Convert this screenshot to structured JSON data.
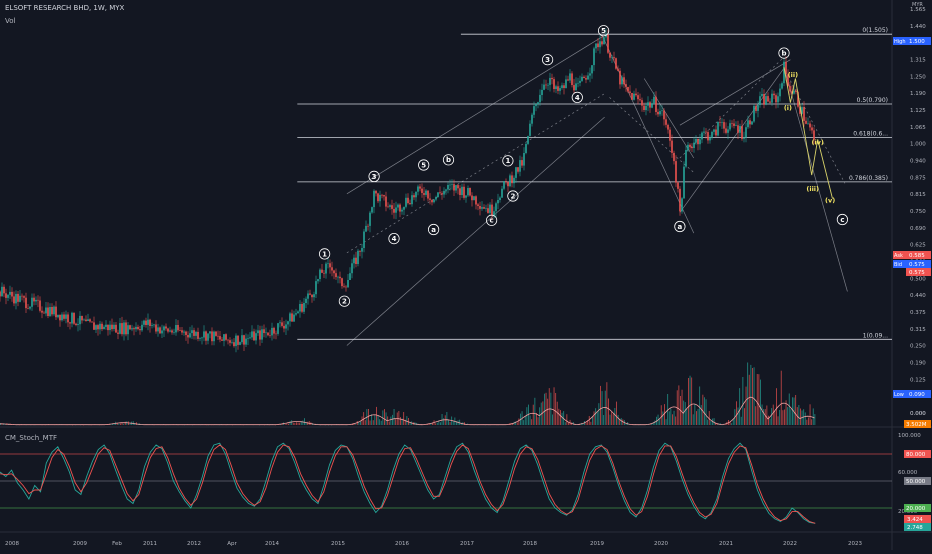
{
  "header": {
    "symbol": "ELSOFT RESEARCH BHD, 1W, MYX",
    "volume_label": "Vol",
    "oscillator_label": "CM_Stoch_MTF",
    "currency": "MYR"
  },
  "colors": {
    "background": "#131722",
    "up": "#26a69a",
    "down": "#ef5350",
    "line": "#d1d4dc",
    "wave_label": "#ffffff",
    "wave_label_yellow": "#f5e663",
    "yellow_line": "#d9d36a",
    "vol_ma": "#f2a0a0",
    "stoch_k": "#26a69a",
    "stoch_d": "#ef5350",
    "level_red": "#ef5350",
    "level_green": "#4caf50"
  },
  "chart_data": [
    {
      "type": "candlestick",
      "pane": "price",
      "title": "ELSOFT RESEARCH BHD, 1W, MYX",
      "y_scale": "log",
      "ylim": [
        0.015,
        1.565
      ],
      "x_axis_labels": [
        "2008",
        "2009",
        "Feb",
        "2011",
        "2012",
        "Apr",
        "2014",
        "2015",
        "2016",
        "2017",
        "2018",
        "2019",
        "2020",
        "2021",
        "2022",
        "2023"
      ],
      "y_axis_ticks": [
        "1.565",
        "1.440",
        "1.375",
        "1.315",
        "1.250",
        "1.190",
        "1.125",
        "1.065",
        "1.000",
        "0.940",
        "0.875",
        "0.815",
        "0.750",
        "0.690",
        "0.625",
        "0.560",
        "0.500",
        "0.440",
        "0.375",
        "0.315",
        "0.250",
        "0.190",
        "0.125",
        "0.065",
        "0.000"
      ],
      "price_path": [
        [
          2007.0,
          0.14
        ],
        [
          2007.5,
          0.128
        ],
        [
          2008.3,
          0.112
        ],
        [
          2008.8,
          0.102
        ],
        [
          2009.5,
          0.1
        ],
        [
          2010.0,
          0.104
        ],
        [
          2010.3,
          0.098
        ],
        [
          2010.8,
          0.096
        ],
        [
          2011.2,
          0.094
        ],
        [
          2011.5,
          0.089
        ],
        [
          2012.0,
          0.091
        ],
        [
          2012.4,
          0.096
        ],
        [
          2012.8,
          0.106
        ],
        [
          2013.0,
          0.116
        ],
        [
          2013.3,
          0.14
        ],
        [
          2013.5,
          0.168
        ],
        [
          2013.7,
          0.178
        ],
        [
          2013.85,
          0.15
        ],
        [
          2014.0,
          0.154
        ],
        [
          2014.3,
          0.215
        ],
        [
          2014.55,
          0.345
        ],
        [
          2014.75,
          0.32
        ],
        [
          2014.95,
          0.295
        ],
        [
          2015.15,
          0.32
        ],
        [
          2015.4,
          0.345
        ],
        [
          2015.55,
          0.36
        ],
        [
          2015.75,
          0.328
        ],
        [
          2015.9,
          0.35
        ],
        [
          2016.1,
          0.365
        ],
        [
          2016.3,
          0.36
        ],
        [
          2016.5,
          0.34
        ],
        [
          2016.8,
          0.305
        ],
        [
          2016.92,
          0.295
        ],
        [
          2017.05,
          0.34
        ],
        [
          2017.25,
          0.385
        ],
        [
          2017.55,
          0.46
        ],
        [
          2017.75,
          0.72
        ],
        [
          2017.95,
          0.95
        ],
        [
          2018.1,
          1.0
        ],
        [
          2018.2,
          0.88
        ],
        [
          2018.35,
          0.905
        ],
        [
          2018.5,
          1.02
        ],
        [
          2018.65,
          0.9
        ],
        [
          2018.9,
          1.1
        ],
        [
          2019.05,
          1.38
        ],
        [
          2019.2,
          1.49
        ],
        [
          2019.35,
          1.2
        ],
        [
          2019.5,
          1.0
        ],
        [
          2019.65,
          0.88
        ],
        [
          2019.85,
          0.83
        ],
        [
          2020.0,
          0.78
        ],
        [
          2020.2,
          0.8
        ],
        [
          2020.4,
          0.7
        ],
        [
          2020.6,
          0.48
        ],
        [
          2020.72,
          0.29
        ],
        [
          2020.85,
          0.52
        ],
        [
          2021.0,
          0.56
        ],
        [
          2021.2,
          0.6
        ],
        [
          2021.4,
          0.59
        ],
        [
          2021.55,
          0.68
        ],
        [
          2021.7,
          0.62
        ],
        [
          2021.85,
          0.65
        ],
        [
          2022.0,
          0.6
        ],
        [
          2022.15,
          0.7
        ],
        [
          2022.35,
          0.82
        ],
        [
          2022.55,
          0.82
        ],
        [
          2022.7,
          0.84
        ],
        [
          2022.82,
          1.11
        ],
        [
          2022.95,
          0.9
        ],
        [
          2023.05,
          0.86
        ],
        [
          2023.15,
          0.76
        ],
        [
          2023.3,
          0.65
        ],
        [
          2023.45,
          0.56
        ]
      ],
      "horizontal_levels": [
        {
          "label": "0(1.505)",
          "value": 1.505
        },
        {
          "label": "0.5(0.790)",
          "value": 0.79
        },
        {
          "label": "0.618(0.6...",
          "value": 0.58
        },
        {
          "label": "0.786(0.385)",
          "value": 0.385
        },
        {
          "label": "1(0.09...",
          "value": 0.09
        }
      ],
      "price_tags": [
        {
          "label": "High",
          "value": "1.500",
          "color": "#2962ff"
        },
        {
          "label": "Ask",
          "value": "0.585",
          "color": "#ef5350"
        },
        {
          "label": "Bid",
          "value": "0.575",
          "color": "#2962ff"
        },
        {
          "label": "",
          "value": "0.575",
          "color": "#ef5350"
        },
        {
          "label": "Low",
          "value": "0.090",
          "color": "#2962ff"
        }
      ],
      "wave_labels": [
        {
          "text": "1",
          "x": 2013.55,
          "y": 0.198,
          "color": "white"
        },
        {
          "text": "2",
          "x": 2013.95,
          "y": 0.128,
          "color": "white"
        },
        {
          "text": "3",
          "x": 2014.55,
          "y": 0.405,
          "color": "white"
        },
        {
          "text": "4",
          "x": 2014.95,
          "y": 0.228,
          "color": "white"
        },
        {
          "text": "5",
          "x": 2015.55,
          "y": 0.45,
          "color": "white"
        },
        {
          "text": "a",
          "x": 2015.75,
          "y": 0.248,
          "color": "white"
        },
        {
          "text": "b",
          "x": 2016.05,
          "y": 0.472,
          "color": "white"
        },
        {
          "text": "c",
          "x": 2016.92,
          "y": 0.27,
          "color": "white"
        },
        {
          "text": "1",
          "x": 2017.25,
          "y": 0.468,
          "color": "white"
        },
        {
          "text": "2",
          "x": 2017.35,
          "y": 0.338,
          "color": "white"
        },
        {
          "text": "3",
          "x": 2018.05,
          "y": 1.19,
          "color": "white"
        },
        {
          "text": "4",
          "x": 2018.65,
          "y": 0.84,
          "color": "white"
        },
        {
          "text": "5",
          "x": 2019.18,
          "y": 1.555,
          "color": "white"
        },
        {
          "text": "a",
          "x": 2020.72,
          "y": 0.255,
          "color": "white"
        },
        {
          "text": "b",
          "x": 2022.82,
          "y": 1.265,
          "color": "white"
        },
        {
          "text": "(ii)",
          "x": 2023.0,
          "y": 1.035,
          "color": "yellow"
        },
        {
          "text": "(i)",
          "x": 2022.9,
          "y": 0.765,
          "color": "yellow"
        },
        {
          "text": "(iv)",
          "x": 2023.5,
          "y": 0.555,
          "color": "yellow"
        },
        {
          "text": "(iii)",
          "x": 2023.4,
          "y": 0.362,
          "color": "yellow"
        },
        {
          "text": "(v)",
          "x": 2023.75,
          "y": 0.325,
          "color": "yellow"
        },
        {
          "text": "c",
          "x": 2024.0,
          "y": 0.272,
          "color": "white"
        }
      ],
      "channels": [
        {
          "from": [
            2014.0,
            0.345
          ],
          "to": [
            2019.2,
            1.49
          ],
          "style": "solid"
        },
        {
          "from": [
            2014.0,
            0.2
          ],
          "to": [
            2019.2,
            0.87
          ],
          "style": "dashed"
        },
        {
          "from": [
            2014.0,
            0.085
          ],
          "to": [
            2019.2,
            0.7
          ],
          "style": "solid"
        },
        {
          "from": [
            2019.15,
            1.49
          ],
          "to": [
            2021.0,
            0.24
          ],
          "style": "solid"
        },
        {
          "from": [
            2019.3,
            0.84
          ],
          "to": [
            2021.0,
            0.42
          ],
          "style": "dashed"
        },
        {
          "from": [
            2020.0,
            1.0
          ],
          "to": [
            2021.0,
            0.48
          ],
          "style": "solid"
        },
        {
          "from": [
            2020.72,
            0.29
          ],
          "to": [
            2022.82,
            1.1
          ],
          "style": "solid"
        },
        {
          "from": [
            2020.72,
            0.48
          ],
          "to": [
            2022.82,
            1.22
          ],
          "style": "dashed"
        },
        {
          "from": [
            2020.72,
            0.65
          ],
          "to": [
            2022.95,
            1.19
          ],
          "style": "solid"
        },
        {
          "from": [
            2022.82,
            1.11
          ],
          "to": [
            2024.1,
            0.14
          ],
          "style": "solid"
        },
        {
          "from": [
            2022.95,
            0.98
          ],
          "to": [
            2024.05,
            0.38
          ],
          "style": "dashed"
        }
      ],
      "projection": [
        [
          2022.82,
          1.11
        ],
        [
          2022.95,
          0.8
        ],
        [
          2023.05,
          1.0
        ],
        [
          2023.38,
          0.41
        ],
        [
          2023.5,
          0.57
        ],
        [
          2023.8,
          0.33
        ]
      ]
    },
    {
      "type": "bar",
      "pane": "volume",
      "ylabel": "Vol",
      "y_axis_ticks": [
        "0.000"
      ],
      "volume_tag": "3.502M",
      "peaks": [
        [
          2007.0,
          0.04
        ],
        [
          2009.5,
          0.08
        ],
        [
          2013.0,
          0.12
        ],
        [
          2014.55,
          0.35
        ],
        [
          2015.0,
          0.22
        ],
        [
          2016.0,
          0.18
        ],
        [
          2017.75,
          0.4
        ],
        [
          2018.1,
          0.55
        ],
        [
          2019.2,
          0.6
        ],
        [
          2020.6,
          0.62
        ],
        [
          2021.0,
          0.72
        ],
        [
          2022.15,
          0.95
        ],
        [
          2022.82,
          0.75
        ],
        [
          2023.3,
          0.3
        ]
      ]
    },
    {
      "type": "line",
      "pane": "oscillator",
      "title": "CM_Stoch_MTF",
      "ylim": [
        0,
        100
      ],
      "y_axis_ticks": [
        "100.000",
        "60.000",
        "20.000"
      ],
      "levels": [
        {
          "value": 80,
          "label": "80.000",
          "color": "#ef5350"
        },
        {
          "value": 50,
          "label": "50.000",
          "color": "#787b86"
        },
        {
          "value": 20,
          "label": "20.000",
          "color": "#4caf50"
        }
      ],
      "current_tags": [
        {
          "value": "3.424",
          "color": "#ef5350"
        },
        {
          "value": "2.748",
          "color": "#26a69a"
        }
      ],
      "series": [
        {
          "values": [
            60,
            55,
            62,
            48,
            40,
            30,
            45,
            38,
            70,
            82,
            88,
            75,
            60,
            40,
            35,
            55,
            72,
            85,
            90,
            80,
            62,
            45,
            30,
            25,
            40,
            66,
            82,
            90,
            86,
            70,
            50,
            38,
            28,
            20,
            35,
            55,
            78,
            90,
            92,
            80,
            60,
            42,
            32,
            25,
            22,
            30,
            50,
            72,
            88,
            92,
            86,
            70,
            52,
            40,
            30,
            25,
            45,
            68,
            84,
            90,
            88,
            75,
            55,
            38,
            25,
            15,
            22,
            40,
            62,
            80,
            90,
            85,
            70,
            55,
            40,
            30,
            35,
            55,
            75,
            88,
            92,
            82,
            62,
            45,
            30,
            20,
            15,
            28,
            50,
            72,
            86,
            90,
            84,
            68,
            48,
            30,
            20,
            15,
            12,
            18,
            35,
            60,
            80,
            88,
            90,
            82,
            65,
            45,
            28,
            15,
            10,
            20,
            40,
            65,
            84,
            92,
            88,
            72,
            52,
            35,
            22,
            12,
            8,
            15,
            30,
            55,
            75,
            86,
            92,
            85,
            62,
            40,
            25,
            14,
            8,
            5,
            10,
            20,
            15,
            8,
            4,
            3
          ]
        },
        {
          "values": [
            58,
            57,
            58,
            52,
            45,
            36,
            40,
            40,
            58,
            76,
            85,
            80,
            66,
            48,
            38,
            48,
            64,
            80,
            87,
            84,
            68,
            52,
            36,
            28,
            35,
            56,
            76,
            86,
            88,
            76,
            58,
            42,
            31,
            23,
            30,
            48,
            70,
            85,
            90,
            85,
            67,
            48,
            36,
            28,
            23,
            27,
            42,
            64,
            82,
            90,
            88,
            76,
            58,
            45,
            34,
            27,
            38,
            60,
            78,
            88,
            88,
            79,
            62,
            44,
            30,
            19,
            20,
            34,
            54,
            74,
            86,
            87,
            75,
            60,
            45,
            33,
            33,
            48,
            68,
            83,
            90,
            86,
            69,
            50,
            35,
            24,
            17,
            24,
            42,
            64,
            80,
            88,
            86,
            74,
            55,
            36,
            24,
            17,
            13,
            16,
            29,
            52,
            73,
            85,
            89,
            85,
            70,
            50,
            33,
            19,
            12,
            16,
            33,
            57,
            78,
            89,
            89,
            77,
            58,
            40,
            26,
            15,
            10,
            13,
            25,
            48,
            69,
            82,
            89,
            87,
            68,
            46,
            30,
            18,
            10,
            6,
            8,
            16,
            16,
            10,
            5,
            3
          ]
        }
      ]
    }
  ]
}
